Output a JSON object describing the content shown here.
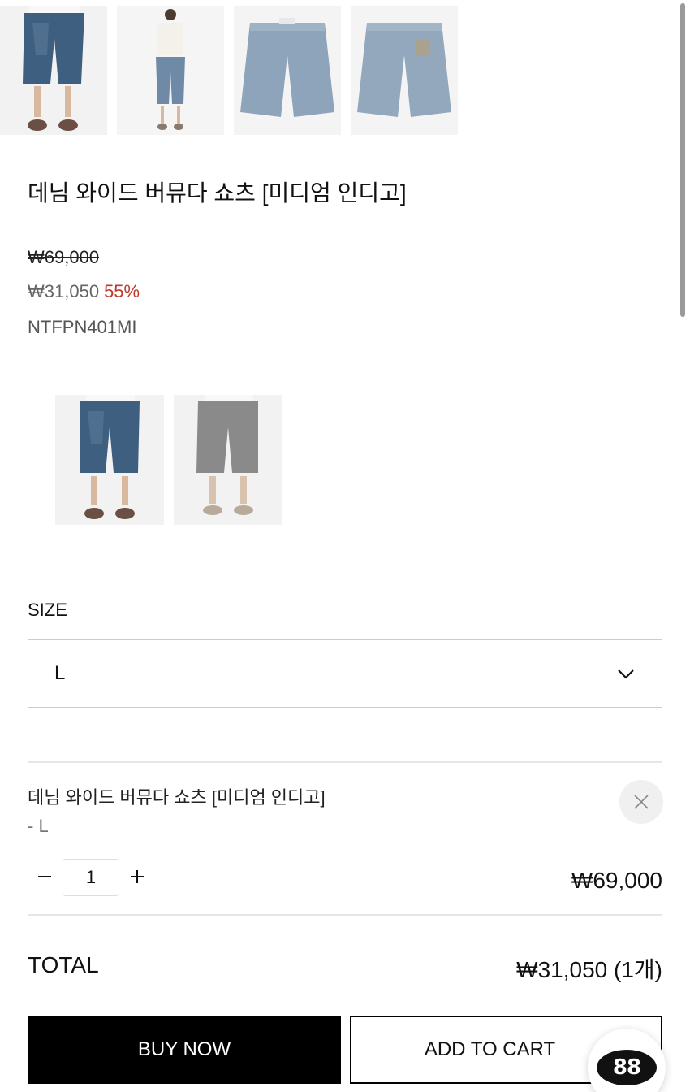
{
  "product": {
    "title": "데님 와이드 버뮤다 쇼츠 [미디엄 인디고]",
    "original_price": "₩69,000",
    "sale_price": "₩31,050",
    "discount": "55%",
    "sku": "NTFPN401MI"
  },
  "gallery": {
    "images": [
      {
        "name": "model-front-closeup",
        "icon": "shorts-photo"
      },
      {
        "name": "model-full-body",
        "icon": "shorts-photo"
      },
      {
        "name": "product-front",
        "icon": "shorts-photo"
      },
      {
        "name": "product-back",
        "icon": "shorts-photo"
      }
    ]
  },
  "color_options": [
    {
      "name": "medium-indigo",
      "icon": "shorts-photo"
    },
    {
      "name": "gray",
      "icon": "shorts-photo"
    }
  ],
  "size": {
    "label": "SIZE",
    "selected": "L"
  },
  "selected_option": {
    "name": "데님 와이드 버뮤다 쇼츠 [미디엄 인디고]",
    "size": "- L",
    "quantity": "1",
    "minus": "−",
    "plus": "+",
    "price": "₩69,000"
  },
  "total": {
    "label": "TOTAL",
    "value": "₩31,050 (1개)"
  },
  "actions": {
    "buy_now": "BUY NOW",
    "add_to_cart": "ADD TO CART"
  },
  "chat": {
    "logo_text": "88"
  },
  "colors": {
    "discount": "#c0392b",
    "primary": "#000000",
    "denim_blue": "#4a6a8a",
    "denim_light": "#8fa3b8",
    "gray_shorts": "#8a8a8a"
  }
}
